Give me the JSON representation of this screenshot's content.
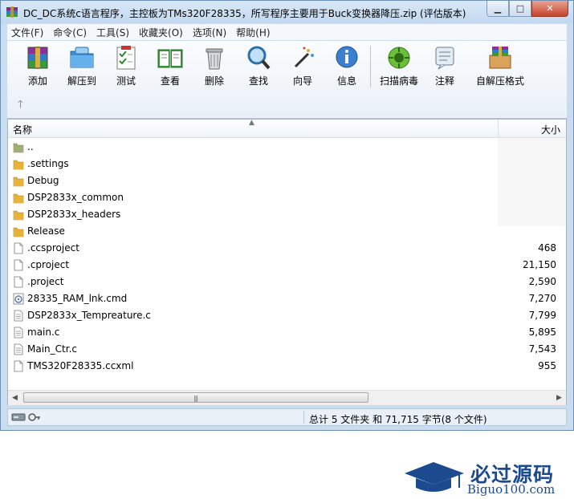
{
  "window": {
    "title": "DC_DC系统c语言程序，主控板为TMs320F28335，所写程序主要用于Buck变换器降压.zip (评估版本)"
  },
  "menu": [
    "文件(F)",
    "命令(C)",
    "工具(S)",
    "收藏夹(O)",
    "选项(N)",
    "帮助(H)"
  ],
  "toolbar": {
    "buttons": [
      {
        "label": "添加",
        "icon": "add-archive-icon"
      },
      {
        "label": "解压到",
        "icon": "extract-folder-icon"
      },
      {
        "label": "测试",
        "icon": "test-checklist-icon"
      },
      {
        "label": "查看",
        "icon": "view-book-icon"
      },
      {
        "label": "删除",
        "icon": "trash-icon"
      },
      {
        "label": "查找",
        "icon": "magnifier-icon"
      },
      {
        "label": "向导",
        "icon": "wizard-wand-icon"
      },
      {
        "label": "信息",
        "icon": "info-icon"
      },
      {
        "label": "扫描病毒",
        "icon": "virus-scan-icon"
      },
      {
        "label": "注释",
        "icon": "comment-icon"
      },
      {
        "label": "自解压格式",
        "icon": "sfx-box-icon"
      }
    ]
  },
  "list": {
    "header_name": "名称",
    "header_size": "大小",
    "files": [
      {
        "name": "..",
        "size": "",
        "type": "up"
      },
      {
        "name": ".settings",
        "size": "",
        "type": "folder"
      },
      {
        "name": "Debug",
        "size": "",
        "type": "folder"
      },
      {
        "name": "DSP2833x_common",
        "size": "",
        "type": "folder"
      },
      {
        "name": "DSP2833x_headers",
        "size": "",
        "type": "folder"
      },
      {
        "name": "Release",
        "size": "",
        "type": "folder"
      },
      {
        "name": ".ccsproject",
        "size": "468",
        "type": "file"
      },
      {
        "name": ".cproject",
        "size": "21,150",
        "type": "file"
      },
      {
        "name": ".project",
        "size": "2,590",
        "type": "file"
      },
      {
        "name": "28335_RAM_lnk.cmd",
        "size": "7,270",
        "type": "cmd"
      },
      {
        "name": "DSP2833x_Tempreature.c",
        "size": "7,799",
        "type": "c"
      },
      {
        "name": "main.c",
        "size": "5,895",
        "type": "c"
      },
      {
        "name": "Main_Ctr.c",
        "size": "7,543",
        "type": "c"
      },
      {
        "name": "TMS320F28335.ccxml",
        "size": "955",
        "type": "file"
      }
    ]
  },
  "status": {
    "summary": "总计 5 文件夹 和 71,715 字节(8 个文件)"
  },
  "watermark": {
    "cn": "必过源码",
    "en": "Biguo100.com"
  },
  "colors": {
    "folder": "#e8b33a",
    "accent": "#1b4a8f"
  }
}
